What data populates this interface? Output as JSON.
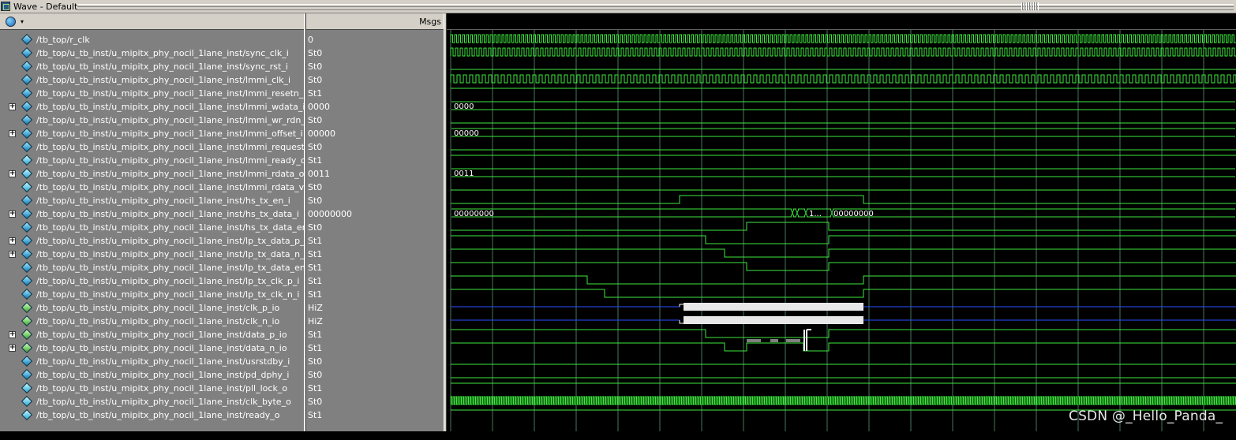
{
  "window": {
    "title": "Wave - Default"
  },
  "header": {
    "msgs_label": "Msgs"
  },
  "colors": {
    "wave": "#3ee83e",
    "hiz": "#2850ff",
    "grid": "#46785a",
    "panel": "#808080",
    "chrome": "#d4d0c8"
  },
  "signals": [
    {
      "name": "/tb_top/r_clk",
      "value": "0",
      "expandable": false,
      "kind": "in"
    },
    {
      "name": "/tb_top/u_tb_inst/u_mipitx_phy_nocil_1lane_inst/sync_clk_i",
      "value": "St0",
      "expandable": false,
      "kind": "in"
    },
    {
      "name": "/tb_top/u_tb_inst/u_mipitx_phy_nocil_1lane_inst/sync_rst_i",
      "value": "St0",
      "expandable": false,
      "kind": "in"
    },
    {
      "name": "/tb_top/u_tb_inst/u_mipitx_phy_nocil_1lane_inst/lmmi_clk_i",
      "value": "St0",
      "expandable": false,
      "kind": "in"
    },
    {
      "name": "/tb_top/u_tb_inst/u_mipitx_phy_nocil_1lane_inst/lmmi_resetn_i",
      "value": "St1",
      "expandable": false,
      "kind": "in"
    },
    {
      "name": "/tb_top/u_tb_inst/u_mipitx_phy_nocil_1lane_inst/lmmi_wdata_i",
      "value": "0000",
      "expandable": true,
      "kind": "in"
    },
    {
      "name": "/tb_top/u_tb_inst/u_mipitx_phy_nocil_1lane_inst/lmmi_wr_rdn_i",
      "value": "St0",
      "expandable": false,
      "kind": "in"
    },
    {
      "name": "/tb_top/u_tb_inst/u_mipitx_phy_nocil_1lane_inst/lmmi_offset_i",
      "value": "00000",
      "expandable": true,
      "kind": "in"
    },
    {
      "name": "/tb_top/u_tb_inst/u_mipitx_phy_nocil_1lane_inst/lmmi_request_i",
      "value": "St0",
      "expandable": false,
      "kind": "in"
    },
    {
      "name": "/tb_top/u_tb_inst/u_mipitx_phy_nocil_1lane_inst/lmmi_ready_o",
      "value": "St1",
      "expandable": false,
      "kind": "out"
    },
    {
      "name": "/tb_top/u_tb_inst/u_mipitx_phy_nocil_1lane_inst/lmmi_rdata_o",
      "value": "0011",
      "expandable": true,
      "kind": "out"
    },
    {
      "name": "/tb_top/u_tb_inst/u_mipitx_phy_nocil_1lane_inst/lmmi_rdata_valid_o",
      "value": "St0",
      "expandable": false,
      "kind": "out"
    },
    {
      "name": "/tb_top/u_tb_inst/u_mipitx_phy_nocil_1lane_inst/hs_tx_en_i",
      "value": "St0",
      "expandable": false,
      "kind": "in"
    },
    {
      "name": "/tb_top/u_tb_inst/u_mipitx_phy_nocil_1lane_inst/hs_tx_data_i",
      "value": "00000000",
      "expandable": true,
      "kind": "in"
    },
    {
      "name": "/tb_top/u_tb_inst/u_mipitx_phy_nocil_1lane_inst/hs_tx_data_en_i",
      "value": "St0",
      "expandable": false,
      "kind": "in"
    },
    {
      "name": "/tb_top/u_tb_inst/u_mipitx_phy_nocil_1lane_inst/lp_tx_data_p_i",
      "value": "St1",
      "expandable": true,
      "kind": "in"
    },
    {
      "name": "/tb_top/u_tb_inst/u_mipitx_phy_nocil_1lane_inst/lp_tx_data_n_i",
      "value": "St1",
      "expandable": true,
      "kind": "in"
    },
    {
      "name": "/tb_top/u_tb_inst/u_mipitx_phy_nocil_1lane_inst/lp_tx_data_en_i",
      "value": "St1",
      "expandable": false,
      "kind": "in"
    },
    {
      "name": "/tb_top/u_tb_inst/u_mipitx_phy_nocil_1lane_inst/lp_tx_clk_p_i",
      "value": "St1",
      "expandable": false,
      "kind": "in"
    },
    {
      "name": "/tb_top/u_tb_inst/u_mipitx_phy_nocil_1lane_inst/lp_tx_clk_n_i",
      "value": "St1",
      "expandable": false,
      "kind": "in"
    },
    {
      "name": "/tb_top/u_tb_inst/u_mipitx_phy_nocil_1lane_inst/clk_p_io",
      "value": "HiZ",
      "expandable": false,
      "kind": "inout"
    },
    {
      "name": "/tb_top/u_tb_inst/u_mipitx_phy_nocil_1lane_inst/clk_n_io",
      "value": "HiZ",
      "expandable": false,
      "kind": "inout"
    },
    {
      "name": "/tb_top/u_tb_inst/u_mipitx_phy_nocil_1lane_inst/data_p_io",
      "value": "St1",
      "expandable": true,
      "kind": "inout"
    },
    {
      "name": "/tb_top/u_tb_inst/u_mipitx_phy_nocil_1lane_inst/data_n_io",
      "value": "St1",
      "expandable": true,
      "kind": "inout"
    },
    {
      "name": "/tb_top/u_tb_inst/u_mipitx_phy_nocil_1lane_inst/usrstdby_i",
      "value": "St0",
      "expandable": false,
      "kind": "in"
    },
    {
      "name": "/tb_top/u_tb_inst/u_mipitx_phy_nocil_1lane_inst/pd_dphy_i",
      "value": "St0",
      "expandable": false,
      "kind": "in"
    },
    {
      "name": "/tb_top/u_tb_inst/u_mipitx_phy_nocil_1lane_inst/pll_lock_o",
      "value": "St1",
      "expandable": false,
      "kind": "out"
    },
    {
      "name": "/tb_top/u_tb_inst/u_mipitx_phy_nocil_1lane_inst/clk_byte_o",
      "value": "St0",
      "expandable": false,
      "kind": "out"
    },
    {
      "name": "/tb_top/u_tb_inst/u_mipitx_phy_nocil_1lane_inst/ready_o",
      "value": "St1",
      "expandable": false,
      "kind": "out"
    }
  ],
  "bus_labels": {
    "wdata": "0000",
    "offset": "00000",
    "rdata": "0011",
    "hs_data_start": "00000000",
    "hs_data_mid": "1...",
    "hs_data_end": "00000000"
  },
  "watermark": "CSDN @_Hello_Panda_"
}
